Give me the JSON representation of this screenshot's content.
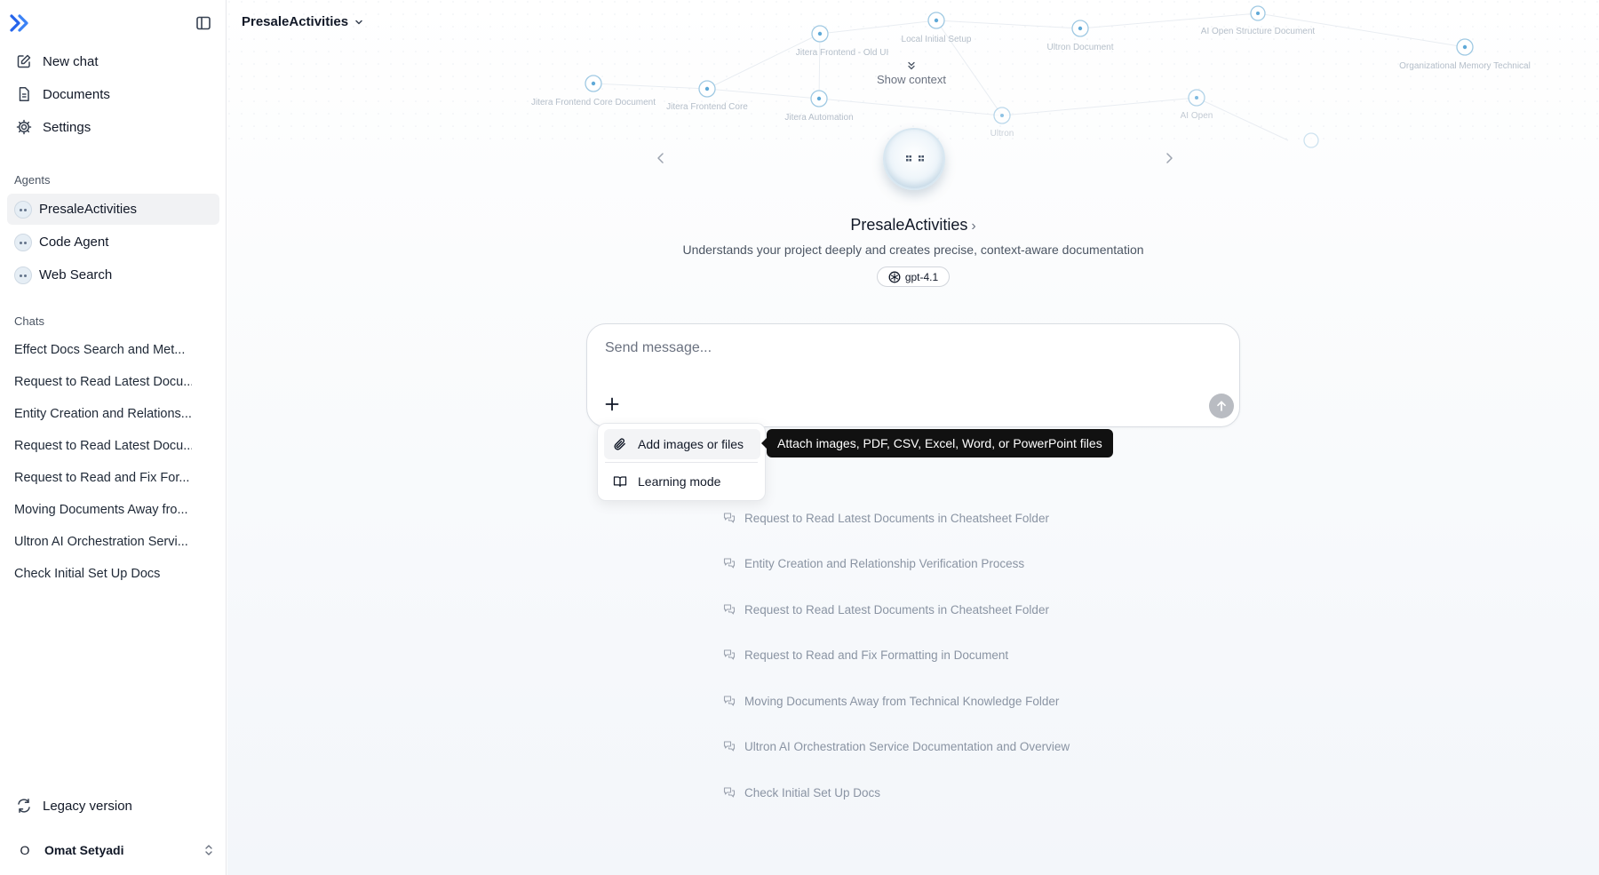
{
  "sidebar": {
    "nav": [
      {
        "label": "New chat",
        "icon": "edit-icon"
      },
      {
        "label": "Documents",
        "icon": "document-icon"
      },
      {
        "label": "Settings",
        "icon": "gear-icon"
      }
    ],
    "agents_label": "Agents",
    "agents": [
      {
        "label": "PresaleActivities",
        "active": true
      },
      {
        "label": "Code Agent",
        "active": false
      },
      {
        "label": "Web Search",
        "active": false
      }
    ],
    "chats_label": "Chats",
    "chats": [
      "Effect Docs Search and Met...",
      "Request to Read Latest Docu...",
      "Entity Creation and Relations...",
      "Request to Read Latest Docu...",
      "Request to Read and Fix For...",
      "Moving Documents Away fro...",
      "Ultron AI Orchestration Servi...",
      "Check Initial Set Up Docs"
    ],
    "legacy_label": "Legacy version",
    "user": {
      "initial": "O",
      "name": "Omat Setyadi"
    }
  },
  "header": {
    "agent_name": "PresaleActivities"
  },
  "graph": {
    "nodes": [
      "Jitera Frontend - Old UI",
      "Local Initial Setup",
      "Ultron Document",
      "AI Open Structure Document",
      "Organizational Memory Technical",
      "Jitera Frontend Core Document",
      "Jitera Frontend Core",
      "Jitera Automation",
      "Ultron",
      "AI Open"
    ],
    "show_context_label": "Show context"
  },
  "agent_card": {
    "title": "PresaleActivities",
    "description": "Understands your project deeply and creates precise, context-aware documentation",
    "model": "gpt-4.1"
  },
  "composer": {
    "placeholder": "Send message..."
  },
  "attach_menu": {
    "items": [
      {
        "label": "Add images or files",
        "icon": "paperclip-icon"
      },
      {
        "label": "Learning mode",
        "icon": "book-icon"
      }
    ],
    "tooltip": "Attach images, PDF, CSV, Excel, Word, or PowerPoint files"
  },
  "recent_chats": [
    "Request to Read Latest Documents in Cheatsheet Folder",
    "Entity Creation and Relationship Verification Process",
    "Request to Read Latest Documents in Cheatsheet Folder",
    "Request to Read and Fix Formatting in Document",
    "Moving Documents Away from Technical Knowledge Folder",
    "Ultron AI Orchestration Service Documentation and Overview",
    "Check Initial Set Up Docs"
  ],
  "colors": {
    "accent": "#2563eb",
    "sidebar_active_bg": "#f1f2f4",
    "tooltip_bg": "#111111",
    "muted_text": "#8a94a3"
  }
}
